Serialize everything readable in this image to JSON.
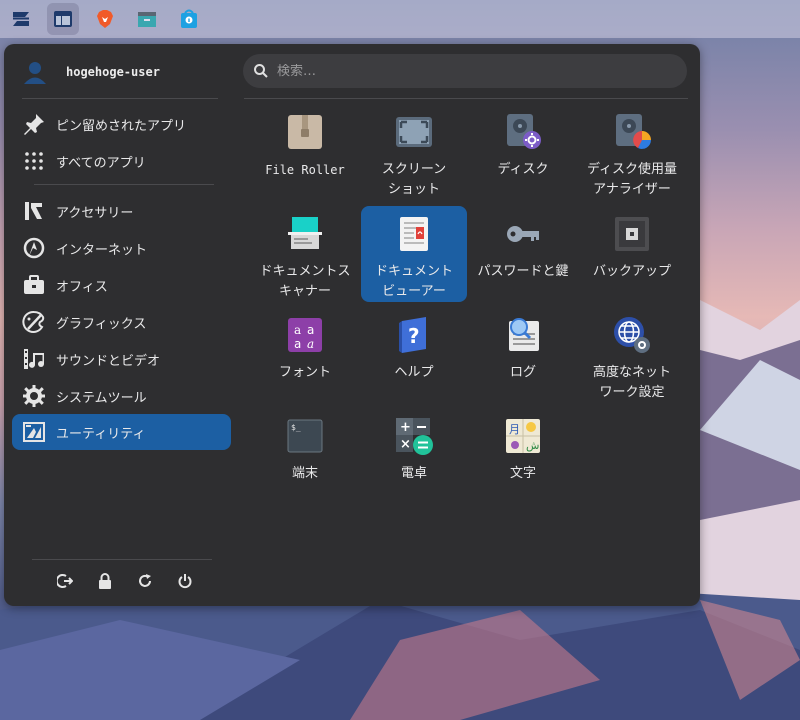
{
  "panel": {
    "items": [
      {
        "name": "zorin-menu-icon",
        "active": false
      },
      {
        "name": "window-switcher-icon",
        "active": true
      },
      {
        "name": "brave-browser-icon",
        "active": false
      },
      {
        "name": "files-icon",
        "active": false
      },
      {
        "name": "software-store-icon",
        "active": false
      }
    ]
  },
  "user": {
    "name": "hogehoge-user"
  },
  "search": {
    "placeholder": "検索…"
  },
  "sidebar": {
    "top_items": [
      {
        "label": "ピン留めされたアプリ",
        "icon": "pin-icon"
      },
      {
        "label": "すべてのアプリ",
        "icon": "grid-dots-icon"
      }
    ],
    "categories": [
      {
        "label": "アクセサリー",
        "icon": "accessories-icon"
      },
      {
        "label": "インターネット",
        "icon": "internet-icon"
      },
      {
        "label": "オフィス",
        "icon": "office-icon"
      },
      {
        "label": "グラフィックス",
        "icon": "graphics-icon"
      },
      {
        "label": "サウンドとビデオ",
        "icon": "sound-video-icon"
      },
      {
        "label": "システムツール",
        "icon": "system-tools-icon"
      },
      {
        "label": "ユーティリティ",
        "icon": "utilities-icon",
        "selected": true
      }
    ],
    "actions": [
      "logout-icon",
      "lock-icon",
      "restart-icon",
      "power-icon"
    ]
  },
  "apps": [
    {
      "label": "File Roller",
      "icon": "file-roller-icon",
      "mono": true
    },
    {
      "label": "スクリーン\nショット",
      "icon": "screenshot-icon"
    },
    {
      "label": "ディスク",
      "icon": "disks-icon"
    },
    {
      "label": "ディスク使用量\nアナライザー",
      "icon": "disk-usage-icon"
    },
    {
      "label": "ドキュメントス\nキャナー",
      "icon": "document-scanner-icon"
    },
    {
      "label": "ドキュメント\nビューアー",
      "icon": "document-viewer-icon",
      "selected": true
    },
    {
      "label": "パスワードと鍵",
      "icon": "passwords-keys-icon"
    },
    {
      "label": "バックアップ",
      "icon": "backup-icon"
    },
    {
      "label": "フォント",
      "icon": "fonts-icon"
    },
    {
      "label": "ヘルプ",
      "icon": "help-icon"
    },
    {
      "label": "ログ",
      "icon": "logs-icon"
    },
    {
      "label": "高度なネット\nワーク設定",
      "icon": "network-settings-icon"
    },
    {
      "label": "端末",
      "icon": "terminal-icon"
    },
    {
      "label": "電卓",
      "icon": "calculator-icon"
    },
    {
      "label": "文字",
      "icon": "characters-icon"
    }
  ],
  "colors": {
    "accent": "#1c5fa3",
    "menu_bg": "#2e2e30"
  }
}
